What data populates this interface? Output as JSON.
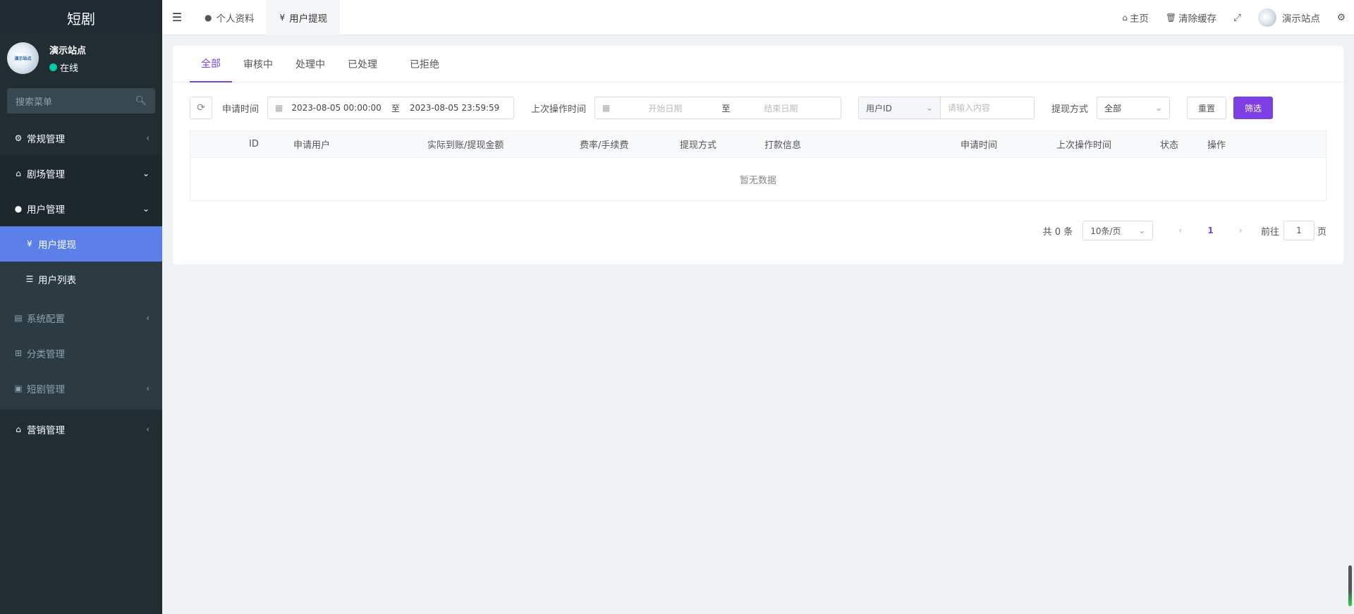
{
  "brand": "短剧",
  "user": {
    "name": "演示站点",
    "status": "在线",
    "logo_text": "演示站点"
  },
  "search": {
    "placeholder": "搜索菜单"
  },
  "menu": [
    {
      "label": "常规管理",
      "icon": "cogs-icon"
    },
    {
      "label": "剧场管理",
      "icon": "home-icon"
    },
    {
      "label": "用户管理",
      "icon": "user-icon"
    },
    {
      "label": "用户提现",
      "icon": "yen-icon"
    },
    {
      "label": "用户列表",
      "icon": "list-icon"
    },
    {
      "label": "系统配置",
      "icon": "file-icon"
    },
    {
      "label": "分类管理",
      "icon": "sitemap-icon"
    },
    {
      "label": "短剧管理",
      "icon": "shopping-bag-icon"
    },
    {
      "label": "营销管理",
      "icon": "home-icon"
    }
  ],
  "topbar": {
    "tabs": [
      {
        "label": "个人资料",
        "icon": "user-icon"
      },
      {
        "label": "用户提现",
        "icon": "yen-icon"
      }
    ],
    "home": "主页",
    "clear_cache": "清除缓存",
    "site_name": "演示站点"
  },
  "status_tabs": [
    "全部",
    "审核中",
    "处理中",
    "已处理",
    "已拒绝"
  ],
  "filters": {
    "apply_time_label": "申请时间",
    "apply_start": "2023-08-05 00:00:00",
    "apply_end": "2023-08-05 23:59:59",
    "range_sep": "至",
    "last_op_label": "上次操作时间",
    "start_placeholder": "开始日期",
    "end_placeholder": "结束日期",
    "field_select": "用户ID",
    "content_placeholder": "请输入内容",
    "method_label": "提现方式",
    "method_value": "全部",
    "reset": "重置",
    "filter": "筛选"
  },
  "table": {
    "columns": [
      "ID",
      "申请用户",
      "实际到账/提现金额",
      "费率/手续费",
      "提现方式",
      "打款信息",
      "申请时间",
      "上次操作时间",
      "状态",
      "操作"
    ],
    "empty": "暂无数据"
  },
  "pager": {
    "total": "共 0 条",
    "page_size": "10条/页",
    "current": "1",
    "goto_label": "前往",
    "goto_value": "1",
    "page_suffix": "页"
  },
  "colors": {
    "accent": "#7b3fe4",
    "sidebar": "#222d32",
    "active_menu": "#5c80e9"
  }
}
